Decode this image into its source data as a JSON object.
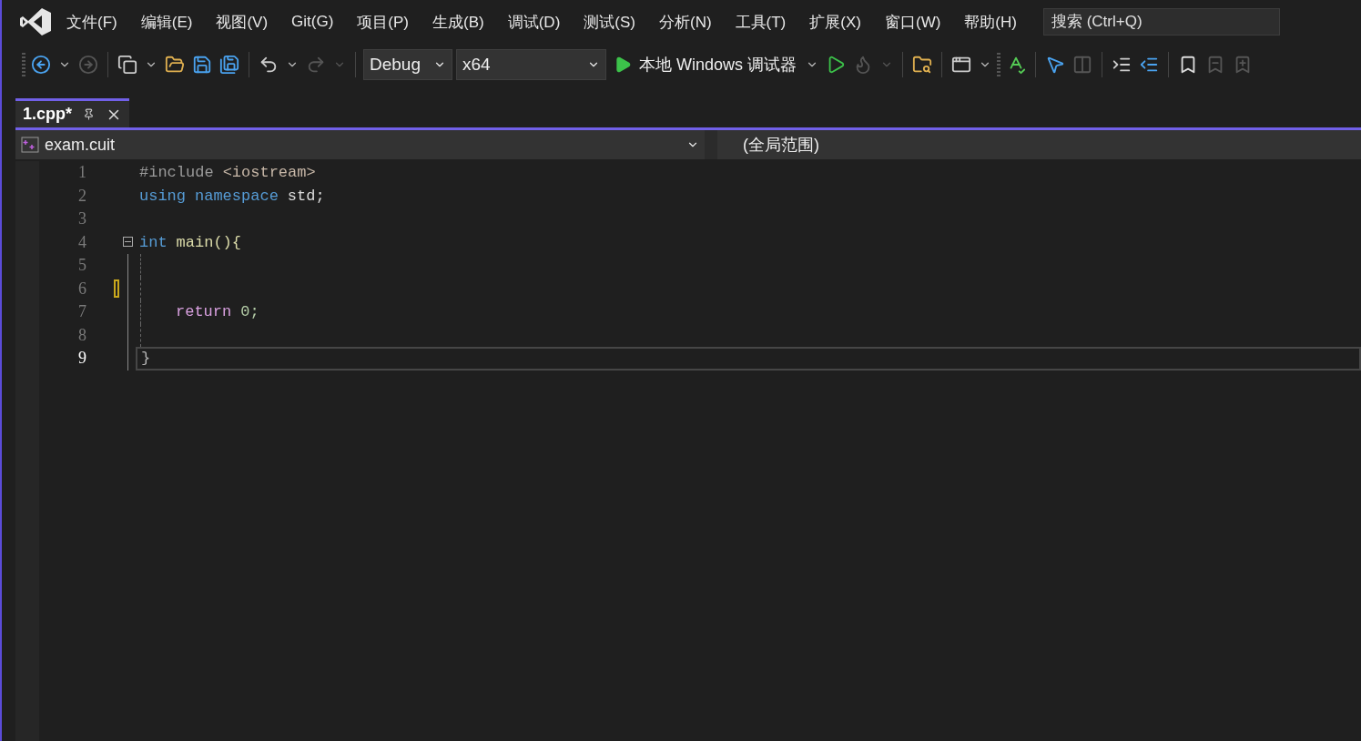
{
  "menu": {
    "items": [
      "文件(F)",
      "编辑(E)",
      "视图(V)",
      "Git(G)",
      "项目(P)",
      "生成(B)",
      "调试(D)",
      "测试(S)",
      "分析(N)",
      "工具(T)",
      "扩展(X)",
      "窗口(W)",
      "帮助(H)"
    ]
  },
  "search": {
    "placeholder": "搜索 (Ctrl+Q)"
  },
  "toolbar": {
    "configuration": "Debug",
    "platform": "x64",
    "run_label": "本地 Windows 调试器"
  },
  "tabs": [
    {
      "label": "1.cpp*",
      "selected": true
    }
  ],
  "navigation": {
    "project": "exam.cuit",
    "scope": "(全局范围)"
  },
  "code": {
    "lines": [
      {
        "number": "1",
        "current": false,
        "modified": false,
        "foldable": false,
        "in_block": false,
        "indented": false,
        "tokens": [
          {
            "text": "#include",
            "kind": "preprocessor"
          },
          {
            "text": "<iostream>",
            "kind": "include"
          }
        ]
      },
      {
        "number": "2",
        "current": false,
        "modified": false,
        "foldable": false,
        "in_block": false,
        "indented": false,
        "tokens": [
          {
            "text": "using",
            "kind": "keyword"
          },
          {
            "text": "namespace",
            "kind": "keyword"
          },
          {
            "text": "std;",
            "kind": "plain"
          }
        ]
      },
      {
        "number": "3",
        "current": false,
        "modified": false,
        "foldable": false,
        "in_block": false
      },
      {
        "number": "4",
        "current": false,
        "modified": false,
        "foldable": true,
        "in_block": false,
        "indented": false,
        "tokens": [
          {
            "text": "int",
            "kind": "keyword"
          },
          {
            "text": "main(){",
            "kind": "function"
          }
        ]
      },
      {
        "number": "5",
        "current": false,
        "modified": false,
        "foldable": false,
        "in_block": true
      },
      {
        "number": "6",
        "current": false,
        "modified": true,
        "foldable": false,
        "in_block": true
      },
      {
        "number": "7",
        "current": false,
        "modified": false,
        "foldable": false,
        "in_block": true,
        "indented": true,
        "tokens": [
          {
            "text": "return",
            "kind": "control"
          },
          {
            "text": "0;",
            "kind": "number"
          }
        ]
      },
      {
        "number": "8",
        "current": false,
        "modified": false,
        "foldable": false,
        "in_block": true
      },
      {
        "number": "9",
        "current": true,
        "modified": false,
        "foldable": false,
        "in_block": true,
        "indented": false,
        "tokens": [
          {
            "text": "}",
            "kind": "brace"
          }
        ]
      }
    ]
  }
}
